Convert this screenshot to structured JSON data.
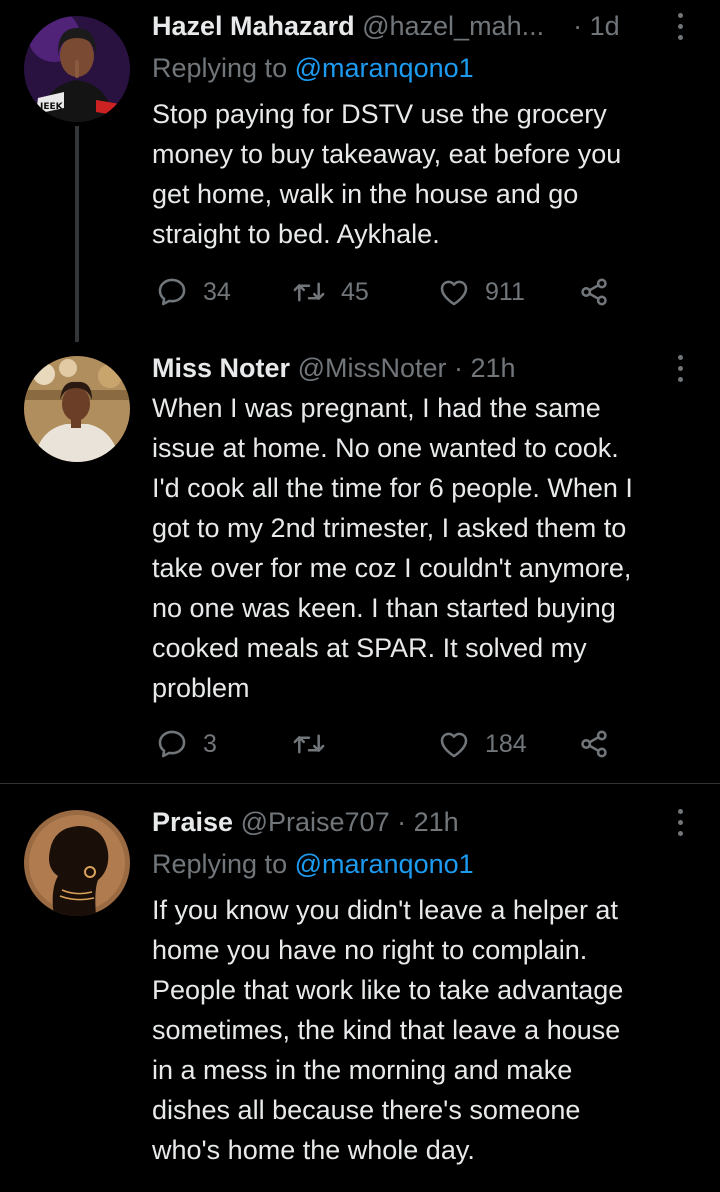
{
  "tweets": [
    {
      "name": "Hazel Mahazard",
      "handle": "@hazel_mah...",
      "separator": "·",
      "time": "1d",
      "replying_prefix": "Replying to",
      "replying_mention": "@maranqono1",
      "body_lines": [
        "Stop paying for DSTV use the grocery",
        "money to buy takeaway, eat before you",
        "get home, walk in the house and go",
        "straight to bed. Aykhale."
      ],
      "avatar_text": "JEEK",
      "replies": "34",
      "retweets": "45",
      "likes": "911"
    },
    {
      "name": "Miss Noter",
      "handle": "@MissNoter",
      "separator": "·",
      "time": "21h",
      "body_lines": [
        "When I was pregnant, I had the same",
        "issue at home. No one wanted to cook.",
        "I'd cook all the time for 6 people. When I",
        "got to my 2nd trimester, I asked them to",
        "take over for me coz I couldn't anymore,",
        "no one was keen. I than started buying",
        "cooked meals at SPAR. It solved my",
        "problem"
      ],
      "replies": "3",
      "retweets": "",
      "likes": "184"
    },
    {
      "name": "Praise",
      "handle": "@Praise707",
      "separator": "·",
      "time": "21h",
      "replying_prefix": "Replying to",
      "replying_mention": "@maranqono1",
      "body_lines": [
        "If you know you didn't leave a helper at",
        "home you have no right to complain.",
        "People that work like to take advantage",
        "sometimes, the kind that leave a house",
        "in a mess in the morning and make",
        "dishes all because there's someone",
        "who's home the whole day."
      ]
    }
  ],
  "icons": {
    "reply": "reply-icon",
    "retweet": "retweet-icon",
    "like": "heart-icon",
    "share": "share-icon",
    "more": "more-vertical-icon"
  },
  "colors": {
    "background": "#000000",
    "text": "#e7e9ea",
    "secondary": "#71767b",
    "link": "#1d9bf0",
    "divider": "#2f3336"
  }
}
